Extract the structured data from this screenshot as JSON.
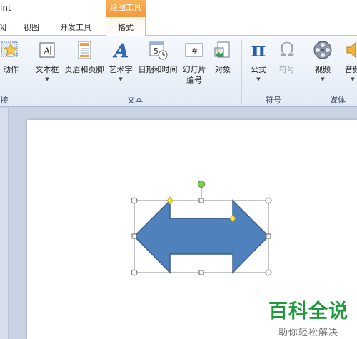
{
  "window": {
    "title": "int",
    "context_tab_group": "绘图工具"
  },
  "tabs": [
    {
      "label": "阅"
    },
    {
      "label": "视图"
    },
    {
      "label": "开发工具"
    },
    {
      "label": "格式"
    }
  ],
  "ribbon": {
    "groups": {
      "links": "接",
      "text": "文本",
      "symbols": "符号",
      "media": "媒体"
    },
    "buttons": {
      "action": "动作",
      "textbox": "文本框",
      "header_footer": "页眉和页脚",
      "wordart": "艺术字",
      "datetime": "日期和时间",
      "slide_number_1": "幻灯片",
      "slide_number_2": "编号",
      "object": "对象",
      "equation": "公式",
      "symbol": "符号",
      "video": "视频",
      "audio": "音频"
    },
    "icons": {
      "equation_glyph": "π",
      "symbol_glyph": "Ω",
      "wordart_glyph": "A",
      "datetime_glyph": "5",
      "slide_number_glyph": "#",
      "dropdown_glyph": "▼"
    }
  },
  "colors": {
    "shape_fill": "#4f81bd",
    "shape_stroke": "#3a5f8e",
    "context_tab": "#f39a3c",
    "watermark": "#1e9a3c"
  },
  "watermark": {
    "main": "百科全说",
    "sub": "助你轻松解决"
  }
}
